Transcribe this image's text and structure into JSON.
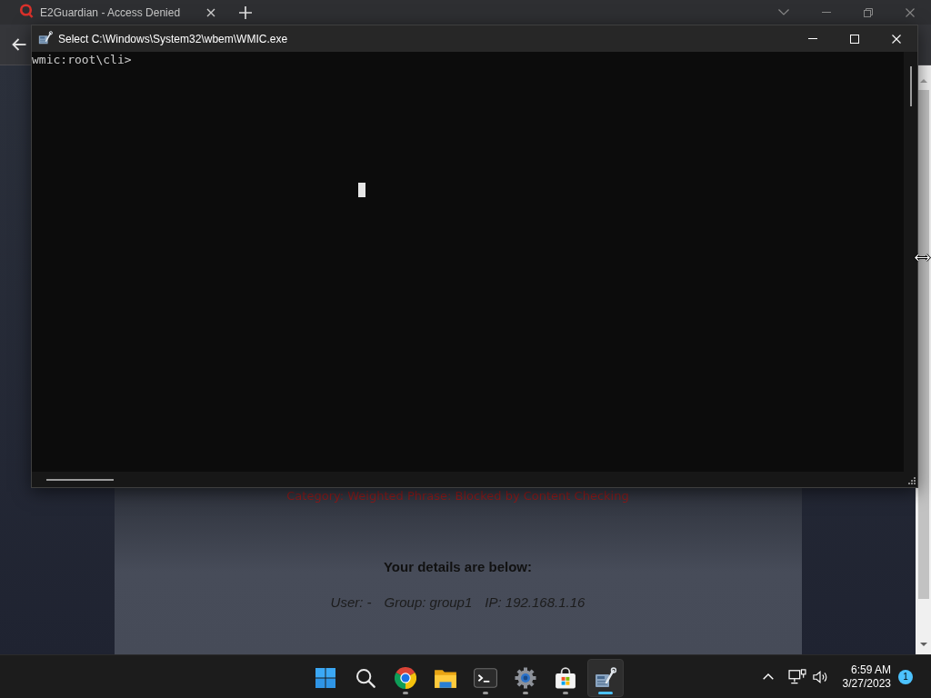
{
  "browser": {
    "tab": {
      "title": "E2Guardian - Access Denied"
    },
    "page": {
      "category_line": "Category: Weighted Phrase: Blocked by Content Checking",
      "details_heading": "Your details are below:",
      "details": [
        "User: -",
        "Group: group1",
        "IP: 192.168.1.16"
      ]
    }
  },
  "console_window": {
    "title": "Select C:\\Windows\\System32\\wbem\\WMIC.exe",
    "lines": [
      "wmic:root\\cli>"
    ]
  },
  "taskbar": {
    "apps": [
      {
        "kind": "start",
        "running": false,
        "selected": false
      },
      {
        "kind": "search",
        "running": false,
        "selected": false
      },
      {
        "kind": "browser",
        "running": true,
        "selected": false
      },
      {
        "kind": "files",
        "running": false,
        "selected": false
      },
      {
        "kind": "terminal",
        "running": true,
        "selected": false
      },
      {
        "kind": "settings",
        "running": true,
        "selected": false
      },
      {
        "kind": "store",
        "running": true,
        "selected": false
      },
      {
        "kind": "tool",
        "running": true,
        "selected": true
      }
    ],
    "clock": {
      "time": "6:59 AM",
      "date": "3/27/2023"
    },
    "notification_count": "1"
  }
}
